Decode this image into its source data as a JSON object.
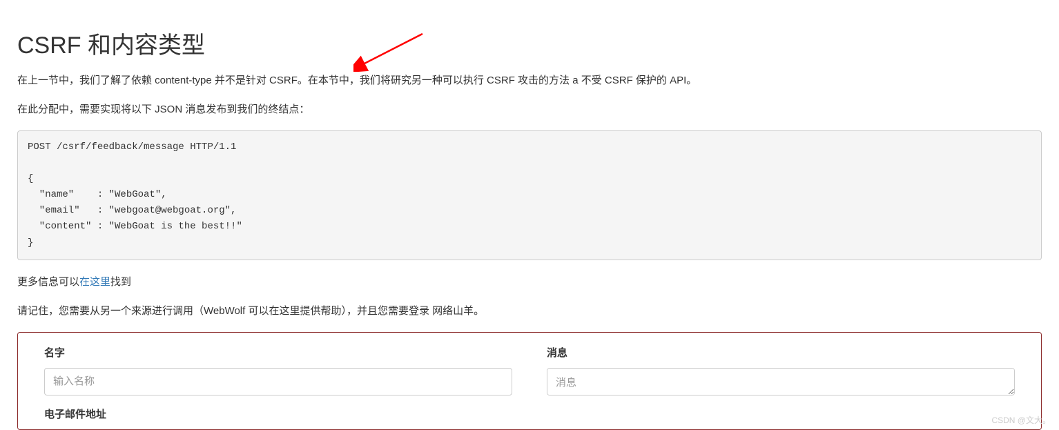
{
  "heading": "CSRF 和内容类型",
  "para1": "在上一节中，我们了解了依赖 content-type 并不是针对 CSRF。在本节中，我们将研究另一种可以执行 CSRF 攻击的方法 a 不受 CSRF 保护的 API。",
  "para2": "在此分配中，需要实现将以下 JSON 消息发布到我们的终结点：",
  "code": "POST /csrf/feedback/message HTTP/1.1\n\n{\n  \"name\"    : \"WebGoat\",\n  \"email\"   : \"webgoat@webgoat.org\",\n  \"content\" : \"WebGoat is the best!!\"\n}",
  "moreinfo_prefix": "更多信息可以",
  "moreinfo_link": "在这里",
  "moreinfo_suffix": "找到",
  "para4": "请记住，您需要从另一个来源进行调用（WebWolf 可以在这里提供帮助），并且您需要登录 网络山羊。",
  "form": {
    "name_label": "名字",
    "name_placeholder": "输入名称",
    "email_label": "电子邮件地址",
    "message_label": "消息",
    "message_placeholder": "消息"
  },
  "watermark": "CSDN @文大。"
}
